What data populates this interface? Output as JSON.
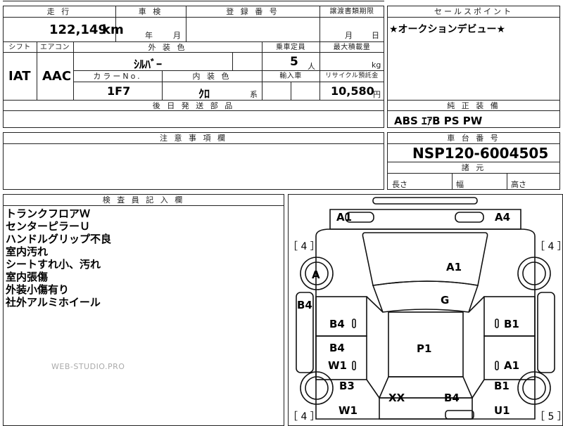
{
  "headers": {
    "mileage": "走 行",
    "inspection": "車 検",
    "registration": "登 録 番 号",
    "transfer_deadline": "譲渡書類期限",
    "sales_point": "セールスポイント",
    "shift": "シフト",
    "aircon": "エアコン",
    "exterior_color": "外 装 色",
    "capacity": "乗車定員",
    "max_load": "最大積載量",
    "color_no": "カラーNo.",
    "interior_color": "内 装 色",
    "import_car": "輸入車",
    "recycle_deposit": "リサイクル預託金",
    "later_parts": "後 日 発 送 部 品",
    "genuine_equipment": "純 正 装 備",
    "notes": "注 意 事 項 欄",
    "chassis_no": "車 台 番 号",
    "dimensions": "諸 元",
    "inspector_notes": "検 査 員 記 入 欄"
  },
  "values": {
    "mileage": "122,149",
    "mileage_unit": "km",
    "inspection_year_unit": "年",
    "inspection_month_unit": "月",
    "transfer_month_unit": "月",
    "transfer_day_unit": "日",
    "sales_point": "★オークションデビュー★",
    "shift": "IAT",
    "aircon": "AAC",
    "exterior_color": "ｼﾙﾊﾞｰ",
    "capacity": "5",
    "capacity_unit": "人",
    "max_load_unit": "kg",
    "color_no": "1F7",
    "interior_color": "ｸﾛ",
    "interior_suffix": "系",
    "recycle_deposit": "10,580",
    "recycle_unit": "円",
    "genuine_equipment": "ABS ｴｱB PS PW",
    "chassis_no": "NSP120-6004505",
    "length_label": "長さ",
    "width_label": "幅",
    "height_label": "高さ"
  },
  "inspector_notes": [
    "トランクフロアＷ",
    "センターピラーＵ",
    "ハンドルグリップ不良",
    "室内汚れ",
    "シートすれ小、汚れ",
    "室内張傷",
    "外装小傷有り",
    "社外アルミホイール"
  ],
  "watermark": "WEB-STUDIO.PRO",
  "diagram": {
    "tire_fl": "［ 4 ］",
    "tire_fr": "［ 4 ］",
    "tire_rl": "［ 4 ］",
    "tire_rr": "［ 5 ］",
    "labels": {
      "front_bumper_left": "A1",
      "front_bumper_right": "A4",
      "front_left_fender": "A",
      "hood": "A1",
      "left_front_door_side": "B4",
      "windshield": "G",
      "left_front_door": "B4",
      "right_front_door": "B1",
      "left_rear_door_upper": "B4",
      "roof": "P1",
      "left_rear_door": "W1",
      "right_rear_door": "A1",
      "left_rear_fender": "B3",
      "right_rear_fender": "B1",
      "trunk_left": "XX",
      "trunk_right": "B4",
      "rear_left": "W1",
      "rear_right": "U1"
    }
  }
}
